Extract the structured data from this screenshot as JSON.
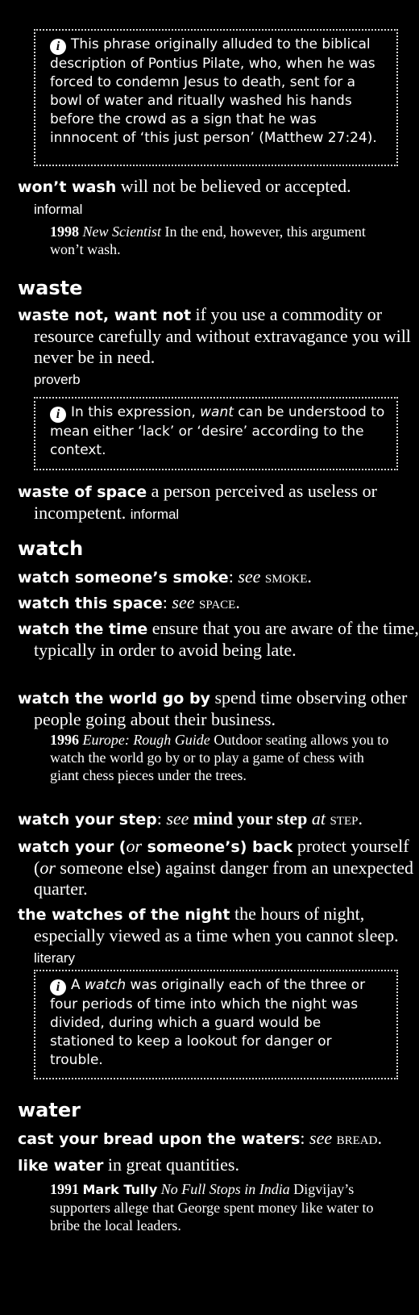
{
  "notes": {
    "pilate": {
      "text": "This phrase originally alluded to the biblical description of Pontius Pilate, who, when he was forced to condemn Jesus to death, sent for a bowl of water and ritually washed his hands before the crowd as a sign that he was innnocent of ‘this just person’ (Matthew 27:24)."
    },
    "want": {
      "pre": "In this expression, ",
      "em": "want",
      "post": " can be understood to mean either ‘lack’ or ‘desire’ according to the context."
    },
    "watch": {
      "pre": "A ",
      "em": "watch",
      "post": " was originally each of the three or four periods of time into which the night was divided, during which a guard would be stationed to keep a lookout for danger or trouble."
    }
  },
  "entries": {
    "wont_wash": {
      "phrase": "won’t wash",
      "def": " will not be believed or accepted.",
      "label": "informal"
    },
    "waste_not": {
      "phrase": "waste not, want not",
      "def": " if you use a commodity or resource carefully and without extravagance you will never be in need.",
      "label": "proverb"
    },
    "waste_space": {
      "phrase": "waste of space",
      "def": " a person perceived as useless or incompetent. ",
      "label": "informal"
    },
    "watch_smoke": {
      "phrase": "watch someone’s smoke",
      "sep": ": ",
      "see": "see",
      "ref": " smoke",
      "end": "."
    },
    "watch_space": {
      "phrase": "watch this space",
      "sep": ": ",
      "see": "see",
      "ref": " space",
      "end": "."
    },
    "watch_time": {
      "phrase": "watch the time",
      "def": " ensure that you are aware of the time, typically in order to avoid being late."
    },
    "watch_world": {
      "phrase": "watch the world go by",
      "def": " spend time observing other people going about their business."
    },
    "watch_step": {
      "phrase": "watch your step",
      "sep": ": ",
      "see": "see",
      "bold_ref": " mind your step",
      "at": " at",
      "ref": " step",
      "end": "."
    },
    "watch_back": {
      "phrase_a": "watch your (",
      "or": "or",
      "phrase_b": " someone’s) back",
      "def_a": " protect yourself (",
      "or2": "or",
      "def_b": " someone else) against danger from an unexpected quarter."
    },
    "watches_night": {
      "phrase": "the watches of the night",
      "def": " the hours of night, especially viewed as a time when you cannot sleep. ",
      "label": "literary"
    },
    "cast_bread": {
      "phrase": "cast your bread upon the waters",
      "sep": ": ",
      "see": "see",
      "ref": " bread",
      "end": "."
    },
    "like_water": {
      "phrase": "like water",
      "def": " in great quantities."
    }
  },
  "headwords": {
    "waste": "waste",
    "watch": "watch",
    "water": "water"
  },
  "quotes": {
    "q1998": {
      "year": "1998",
      "source": "New Scientist",
      "text": " In the end, however, this argument won’t wash."
    },
    "q1996": {
      "year": "1996",
      "source": "Europe: Rough Guide",
      "text": " Outdoor seating allows you to watch the world go by or to play a game of chess with giant chess pieces under the trees."
    },
    "q1991": {
      "year": "1991",
      "author": "Mark Tully",
      "source": "No Full Stops in India",
      "text": " Digvijay’s supporters allege that George spent money like water to bribe the local leaders."
    }
  }
}
